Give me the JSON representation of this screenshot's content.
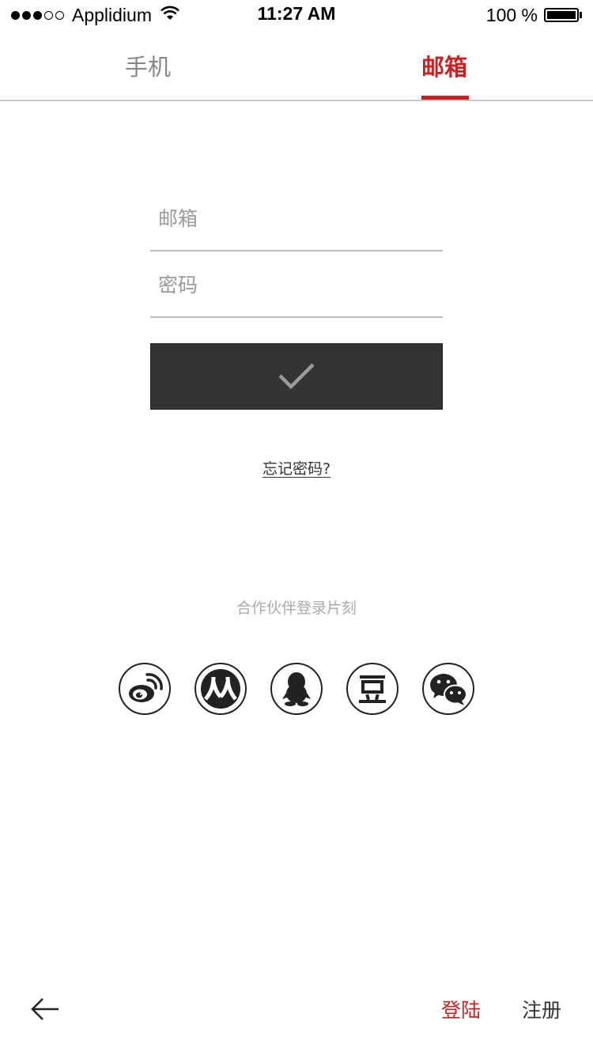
{
  "status_bar": {
    "carrier": "Applidium",
    "time": "11:27 AM",
    "battery_text": "100 %",
    "signal_dots_filled": 3,
    "signal_dots_total": 5,
    "battery_level": 1.0,
    "icons": [
      "signal-dots-icon",
      "wifi-icon",
      "battery-icon"
    ]
  },
  "tabs": [
    {
      "label": "手机",
      "active": false
    },
    {
      "label": "邮箱",
      "active": true
    }
  ],
  "form": {
    "email_placeholder": "邮箱",
    "email_value": "",
    "password_placeholder": "密码",
    "password_value": "",
    "submit_icon": "checkmark-icon"
  },
  "forgot_password": "忘记密码?",
  "partner_login_label": "合作伙伴登录片刻",
  "social_logins": [
    {
      "icon": "weibo-icon"
    },
    {
      "icon": "renren-icon"
    },
    {
      "icon": "qq-icon"
    },
    {
      "icon": "douban-icon"
    },
    {
      "icon": "wechat-icon"
    }
  ],
  "footer": {
    "back_icon": "arrow-left-icon",
    "login_label": "登陆",
    "register_label": "注册"
  },
  "colors": {
    "accent": "#cc1f1f",
    "button_bg": "#333333",
    "muted_text": "#aaaaaa",
    "divider": "#c8c8c8"
  }
}
